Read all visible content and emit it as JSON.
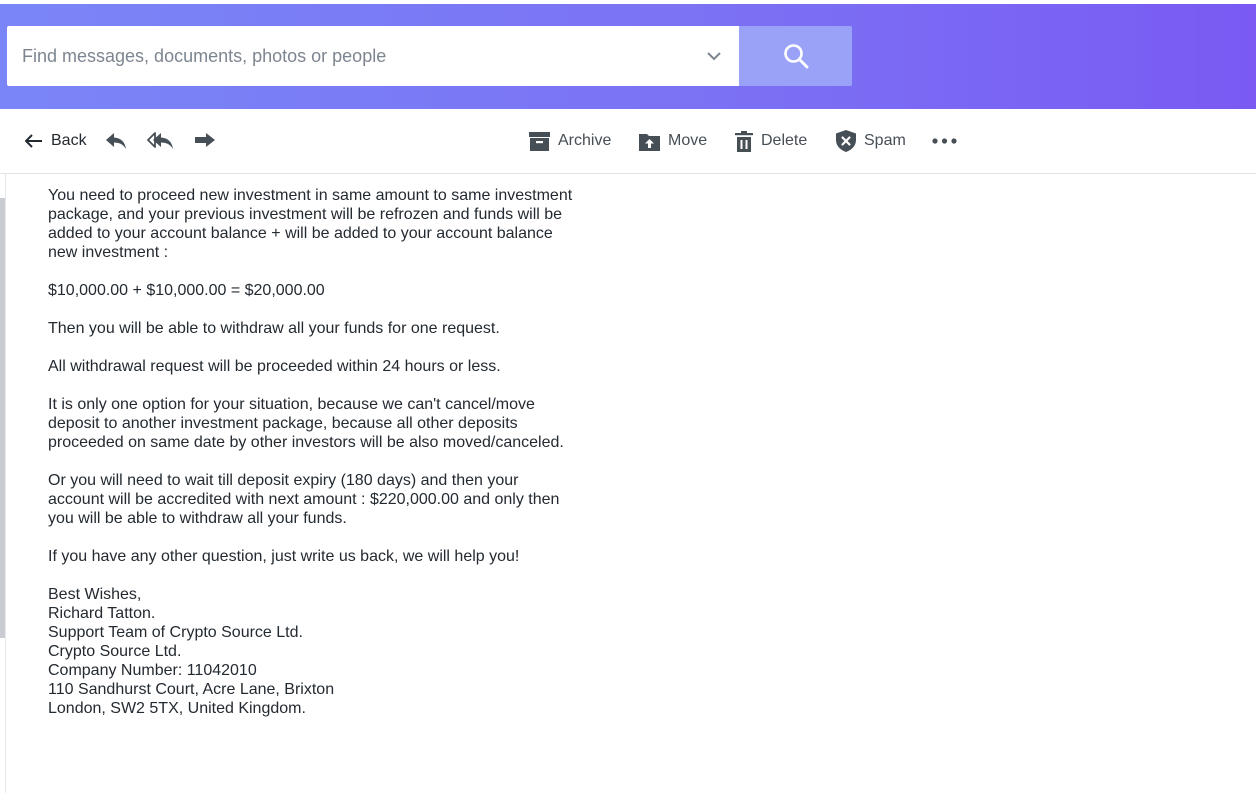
{
  "search": {
    "placeholder": "Find messages, documents, photos or people",
    "value": ""
  },
  "toolbar": {
    "back_label": "Back",
    "archive_label": "Archive",
    "move_label": "Move",
    "delete_label": "Delete",
    "spam_label": "Spam"
  },
  "colors": {
    "header_gradient_start": "#7a86f7",
    "header_gradient_end": "#7a5af3",
    "search_button": "#9aa2f7",
    "toolbar_text": "#464e56",
    "body_text": "#232a31"
  },
  "message": {
    "paragraphs": [
      [
        "You need to proceed new investment in same amount to same investment",
        "package, and your previous investment will be refrozen and funds will be",
        "added to your account balance + will be added to your account balance",
        "new investment :"
      ],
      [
        "$10,000.00 + $10,000.00 = $20,000.00"
      ],
      [
        "Then you will be able to withdraw all your funds for one request."
      ],
      [
        "All withdrawal request will be proceeded within 24 hours or less."
      ],
      [
        "It is only one option for your situation, because we can't cancel/move",
        "deposit to another investment package, because all other deposits",
        "proceeded on same date by other investors will be also moved/canceled."
      ],
      [
        "Or you will need to wait till deposit expiry (180 days) and then your",
        "account will be accredited with next amount : $220,000.00 and only then",
        "you will be able to withdraw all your funds."
      ],
      [
        "If you have any other question, just write us back, we will help you!"
      ],
      [
        "Best Wishes,",
        "Richard Tatton.",
        "Support Team of Crypto Source Ltd.",
        "Crypto Source Ltd.",
        "Company Number: 11042010",
        "110 Sandhurst Court, Acre Lane, Brixton",
        "London, SW2 5TX, United Kingdom."
      ]
    ]
  }
}
